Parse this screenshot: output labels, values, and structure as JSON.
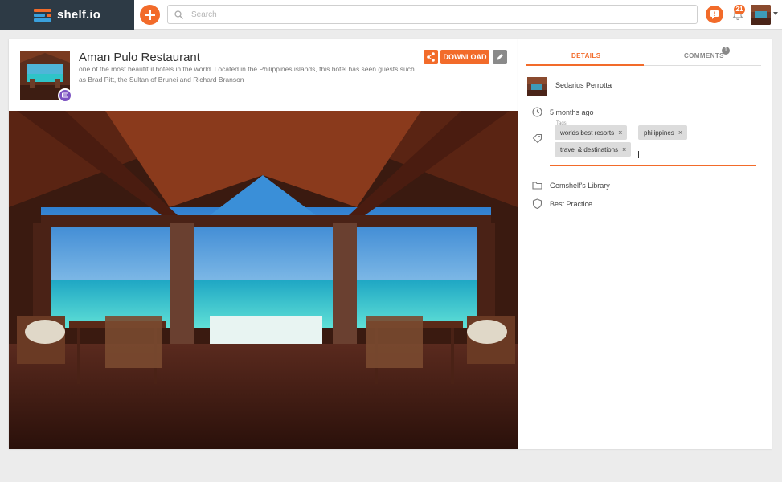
{
  "app": {
    "brand_name": "shelf.io",
    "accent_color": "#f26b2a",
    "brand_bg": "#2d3a45"
  },
  "topbar": {
    "add_icon": "plus-icon",
    "search_placeholder": "Search",
    "notification_count": "21"
  },
  "gem": {
    "title": "Aman Pulo Restaurant",
    "description": "one of the most beautiful hotels in the world. Located in the Philippines islands, this hotel has seen guests such as Brad Pitt, the Sultan of Brunei and Richard Branson",
    "download_label": "DOWNLOAD"
  },
  "panel": {
    "tabs": {
      "details_label": "DETAILS",
      "comments_label": "COMMENTS",
      "comments_count": "1"
    },
    "owner_name": "Sedarius Perrotta",
    "time_ago": "5 months ago",
    "tags_label": "Tags",
    "tags": [
      "worlds best resorts",
      "philippines",
      "travel & destinations"
    ],
    "library": "Gemshelf's Library",
    "category": "Best Practice"
  }
}
